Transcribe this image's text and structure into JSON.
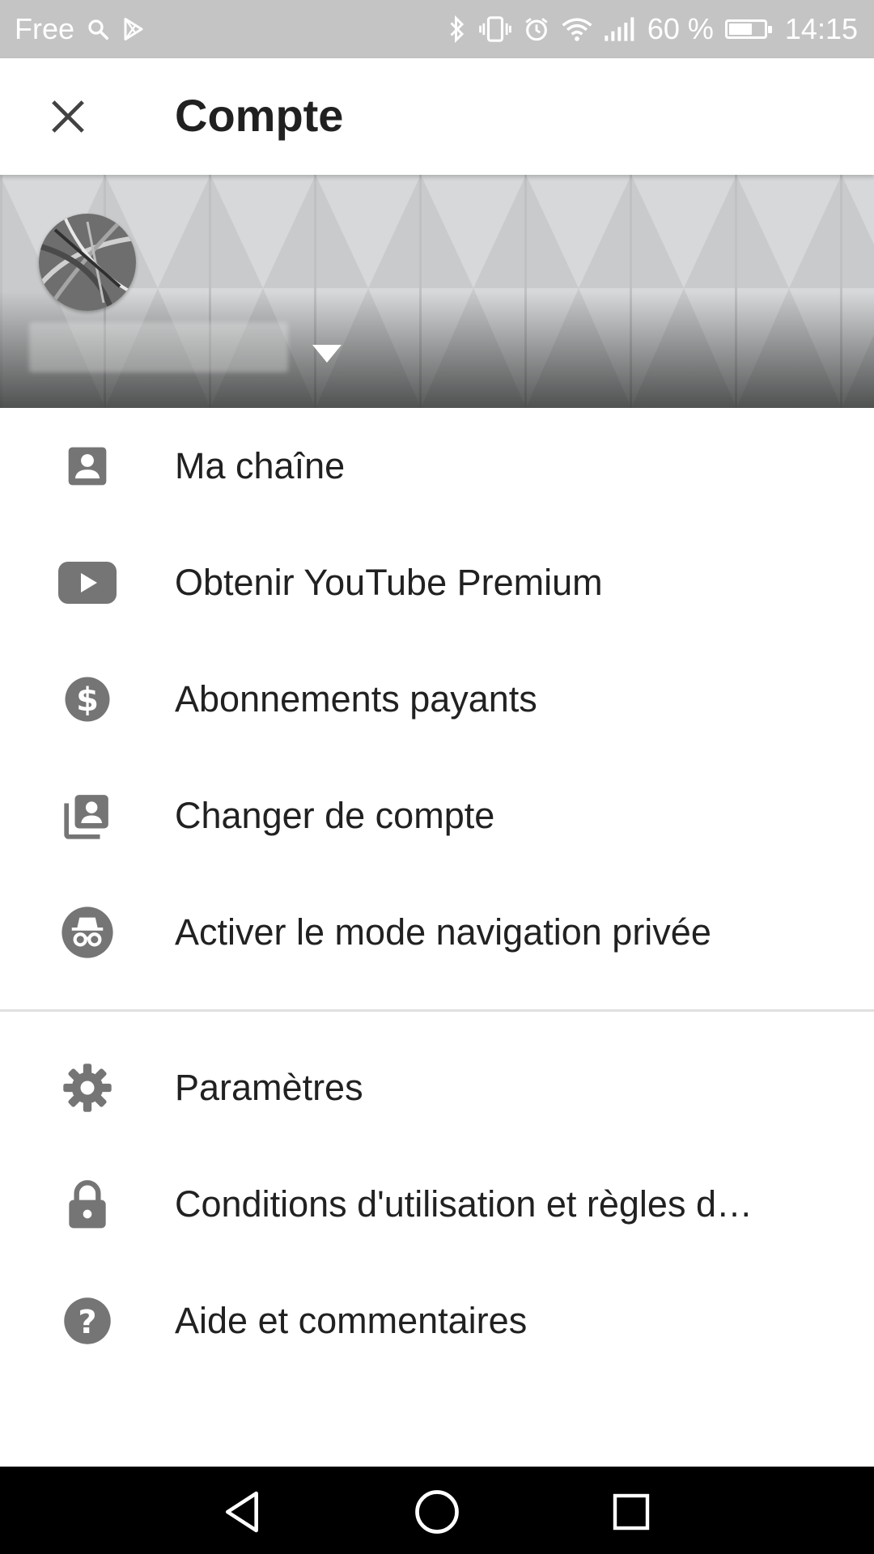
{
  "status_bar": {
    "carrier": "Free",
    "battery_percent": "60 %",
    "battery_level": 0.6,
    "time": "14:15"
  },
  "app_bar": {
    "title": "Compte",
    "close_icon": "close-icon"
  },
  "account_header": {
    "avatar_icon": "avatar",
    "switch_icon": "dropdown-arrow-icon"
  },
  "menu": {
    "items": [
      {
        "label": "Ma chaîne",
        "icon": "person-icon"
      },
      {
        "label": "Obtenir YouTube Premium",
        "icon": "youtube-play-icon"
      },
      {
        "label": "Abonnements payants",
        "icon": "dollar-icon"
      },
      {
        "label": "Changer de compte",
        "icon": "switch-account-icon"
      },
      {
        "label": "Activer le mode navigation privée",
        "icon": "incognito-icon"
      }
    ],
    "secondary_items": [
      {
        "label": "Paramètres",
        "icon": "gear-icon"
      },
      {
        "label": "Conditions d'utilisation et règles d…",
        "icon": "lock-icon"
      },
      {
        "label": "Aide et commentaires",
        "icon": "help-icon"
      }
    ]
  },
  "colors": {
    "icon_gray": "#757575",
    "text": "#212121",
    "status_bar": "#c4c4c4",
    "nav_bar": "#000000"
  }
}
